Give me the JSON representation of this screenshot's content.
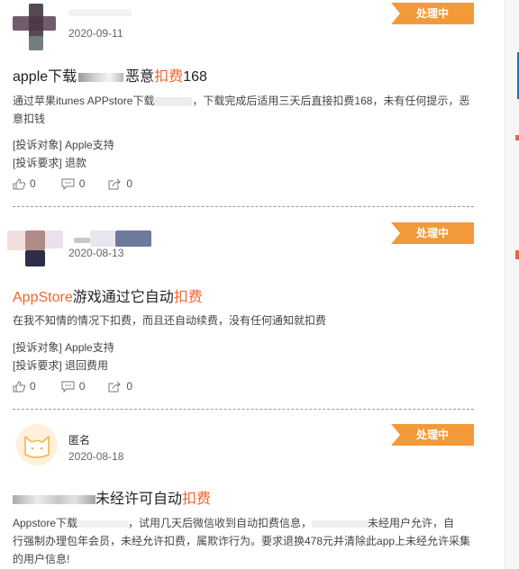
{
  "complaints": [
    {
      "date": "2020-09-11",
      "status": "处理中",
      "title_pre": "apple下载",
      "title_post": "恶意",
      "title_hl": "扣费",
      "title_tail": "168",
      "desc_a": "通过苹果itunes APPstore下载",
      "desc_b": "，下载完成后适用三天后直接扣费168，未有任何提示，恶意扣钱",
      "target_label": "[投诉对象]",
      "target": "Apple支持",
      "demand_label": "[投诉要求]",
      "demand": "退款",
      "likes": "0",
      "comments": "0",
      "shares": "0"
    },
    {
      "date": "2020-08-13",
      "status": "处理中",
      "title_accent": "AppStore",
      "title_mid": "游戏通过它自动",
      "title_hl": "扣费",
      "desc": "在我不知情的情况下扣费，而且还自动续费，没有任何通知就扣费",
      "target_label": "[投诉对象]",
      "target": "Apple支持",
      "demand_label": "[投诉要求]",
      "demand": "退回费用",
      "likes": "0",
      "comments": "0",
      "shares": "0"
    },
    {
      "username": "匿名",
      "date": "2020-08-18",
      "status": "处理中",
      "title_mid": "未经许可自动",
      "title_hl": "扣费",
      "desc_line1a": "Appstore下载",
      "desc_line1b": "，试用几天后微信收到自动扣费信息，",
      "desc_line1c": "未经用户允许，自",
      "desc_line2": "行强制办理包年会员，未经允许扣费，属欺诈行为。要求退换478元并清除此app上未经允许采集",
      "desc_line3": "的用户信息!"
    }
  ],
  "colors": {
    "badge": "#f29a3a",
    "highlight": "#f0652f"
  },
  "icons": [
    "thumbs-up-icon",
    "comment-icon",
    "share-icon"
  ]
}
